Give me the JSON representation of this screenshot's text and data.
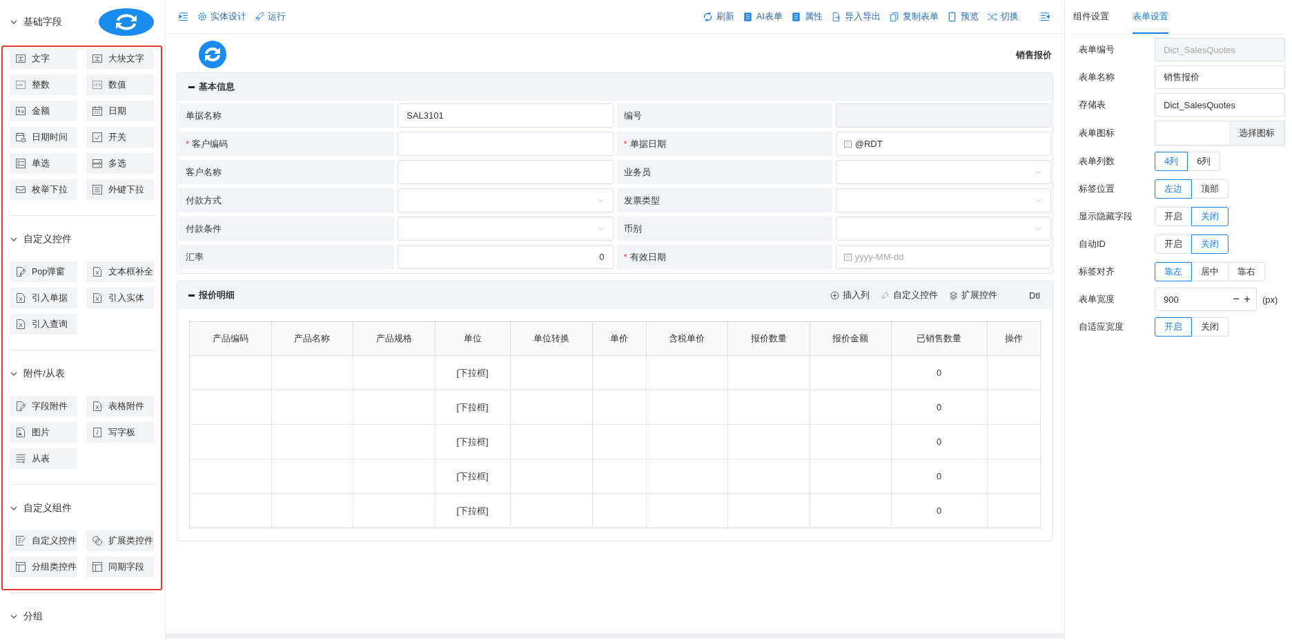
{
  "sidebar": {
    "highlighted": true,
    "groups": [
      {
        "title": "基础字段",
        "expanded": true,
        "items": [
          {
            "label": "文字",
            "kind": "text"
          },
          {
            "label": "大块文字",
            "kind": "text"
          },
          {
            "label": "整数",
            "kind": "integer"
          },
          {
            "label": "数值",
            "kind": "number"
          },
          {
            "label": "金额",
            "kind": "money"
          },
          {
            "label": "日期",
            "kind": "date"
          },
          {
            "label": "日期时间",
            "kind": "datetime"
          },
          {
            "label": "开关",
            "kind": "switch"
          },
          {
            "label": "单选",
            "kind": "radio"
          },
          {
            "label": "多选",
            "kind": "checkbox"
          },
          {
            "label": "枚举下拉",
            "kind": "enum"
          },
          {
            "label": "外键下拉",
            "kind": "foreign"
          }
        ]
      },
      {
        "title": "自定义控件",
        "expanded": true,
        "items": [
          {
            "label": "Pop弹窗",
            "kind": "edit-file"
          },
          {
            "label": "文本框补全",
            "kind": "excel-file"
          },
          {
            "label": "引入单据",
            "kind": "excel-file"
          },
          {
            "label": "引入实体",
            "kind": "excel-file"
          },
          {
            "label": "引入查询",
            "kind": "excel-file"
          }
        ]
      },
      {
        "title": "附件/从表",
        "expanded": true,
        "items": [
          {
            "label": "字段附件",
            "kind": "edit-file"
          },
          {
            "label": "表格附件",
            "kind": "excel-file"
          },
          {
            "label": "图片",
            "kind": "image"
          },
          {
            "label": "写字板",
            "kind": "italic"
          },
          {
            "label": "从表",
            "kind": "subtable"
          }
        ]
      },
      {
        "title": "自定义组件",
        "expanded": true,
        "items": [
          {
            "label": "自定义控件",
            "kind": "edit-lines"
          },
          {
            "label": "扩展类控件",
            "kind": "overlap"
          },
          {
            "label": "分组类控件",
            "kind": "layout"
          },
          {
            "label": "同期字段",
            "kind": "layout"
          }
        ]
      },
      {
        "title": "分组",
        "expanded": true
      }
    ]
  },
  "toolbar": {
    "left": [
      {
        "label": "实体设计",
        "kind": "gear"
      },
      {
        "label": "运行",
        "kind": "rocket"
      }
    ],
    "right": [
      {
        "label": "刷新",
        "kind": "refresh"
      },
      {
        "label": "AI表单",
        "kind": "doc"
      },
      {
        "label": "属性",
        "kind": "doc"
      },
      {
        "label": "导入导出",
        "kind": "import"
      },
      {
        "label": "复制表单",
        "kind": "copy"
      },
      {
        "label": "预览",
        "kind": "phone"
      },
      {
        "label": "切换",
        "kind": "shuffle"
      }
    ]
  },
  "form": {
    "title": "销售报价",
    "sections": [
      {
        "title": "基本信息",
        "expanded": true,
        "fields": [
          {
            "label": "单据名称",
            "kind": "text",
            "value": "SAL3101"
          },
          {
            "label": "编号",
            "kind": "readonly"
          },
          {
            "label": "客户编码",
            "required_mark": "*",
            "kind": "text"
          },
          {
            "label": "单据日期",
            "required_mark": "*",
            "kind": "date",
            "value": "@RDT"
          },
          {
            "label": "客户名称",
            "kind": "text"
          },
          {
            "label": "业务员",
            "kind": "select"
          },
          {
            "label": "付款方式",
            "kind": "select"
          },
          {
            "label": "发票类型",
            "kind": "select"
          },
          {
            "label": "付款条件",
            "kind": "select"
          },
          {
            "label": "币别",
            "kind": "select"
          },
          {
            "label": "汇率",
            "kind": "number",
            "value": "0"
          },
          {
            "label": "有效日期",
            "required_mark": "*",
            "kind": "date",
            "placeholder": "yyyy-MM-dd"
          }
        ]
      }
    ],
    "detail": {
      "title": "报价明细",
      "expanded": true,
      "actions": [
        {
          "label": "插入列",
          "kind": "plus"
        },
        {
          "label": "自定义控件",
          "kind": "link"
        },
        {
          "label": "扩展控件",
          "kind": "layers"
        }
      ],
      "tag": "Dtl",
      "columns": [
        "产品编码",
        "产品名称",
        "产品规格",
        "单位",
        "单位转换",
        "单价",
        "含税单价",
        "报价数量",
        "报价金额",
        "已销售数量",
        "操作"
      ],
      "rows": [
        [
          null,
          null,
          null,
          "[下拉框]",
          null,
          null,
          null,
          null,
          null,
          "0",
          null
        ],
        [
          null,
          null,
          null,
          "[下拉框]",
          null,
          null,
          null,
          null,
          null,
          "0",
          null
        ],
        [
          null,
          null,
          null,
          "[下拉框]",
          null,
          null,
          null,
          null,
          null,
          "0",
          null
        ],
        [
          null,
          null,
          null,
          "[下拉框]",
          null,
          null,
          null,
          null,
          null,
          "0",
          null
        ],
        [
          null,
          null,
          null,
          "[下拉框]",
          null,
          null,
          null,
          null,
          null,
          "0",
          null
        ]
      ]
    }
  },
  "settings": {
    "tabs": [
      {
        "label": "组件设置",
        "selected": false
      },
      {
        "label": "表单设置",
        "selected": true
      }
    ],
    "rows": [
      {
        "label": "表单编号",
        "kind": "readonly",
        "value": "Dict_SalesQuotes"
      },
      {
        "label": "表单名称",
        "kind": "input",
        "value": "销售报价"
      },
      {
        "label": "存储表",
        "kind": "input",
        "value": "Dict_SalesQuotes"
      },
      {
        "label": "表单图标",
        "kind": "icon-picker",
        "button": "选择图标"
      },
      {
        "label": "表单列数",
        "kind": "segmented",
        "options": [
          {
            "label": "4列",
            "selected": true
          },
          {
            "label": "6列",
            "selected": false
          }
        ]
      },
      {
        "label": "标签位置",
        "kind": "segmented",
        "options": [
          {
            "label": "左边",
            "selected": true
          },
          {
            "label": "顶部",
            "selected": false
          }
        ]
      },
      {
        "label": "显示隐藏字段",
        "kind": "segmented",
        "options": [
          {
            "label": "开启",
            "selected": false
          },
          {
            "label": "关闭",
            "selected": true
          }
        ]
      },
      {
        "label": "自动ID",
        "kind": "segmented",
        "options": [
          {
            "label": "开启",
            "selected": false
          },
          {
            "label": "关闭",
            "selected": true
          }
        ]
      },
      {
        "label": "标签对齐",
        "kind": "segmented",
        "options": [
          {
            "label": "靠左",
            "selected": true
          },
          {
            "label": "居中",
            "selected": false
          },
          {
            "label": "靠右",
            "selected": false
          }
        ]
      },
      {
        "label": "表单宽度",
        "kind": "stepper",
        "value": "900",
        "minus": "−",
        "plus": "+",
        "unit": "(px)"
      },
      {
        "label": "自适应宽度",
        "kind": "segmented",
        "options": [
          {
            "label": "开启",
            "selected": true
          },
          {
            "label": "关闭",
            "selected": false
          }
        ]
      }
    ]
  }
}
